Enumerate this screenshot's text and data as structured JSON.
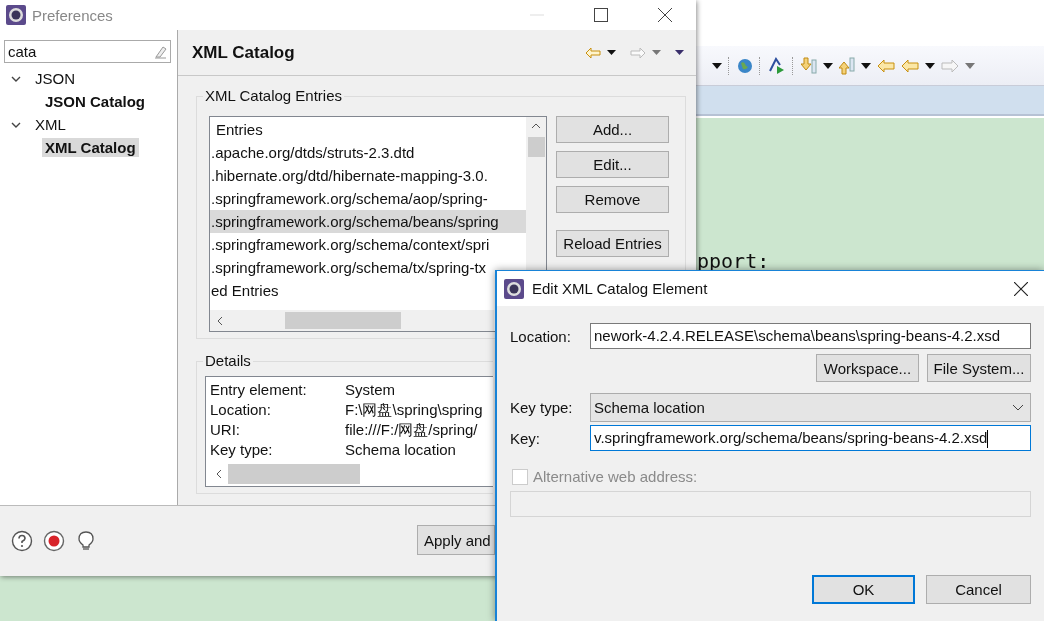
{
  "ide": {
    "editor_text": "pport:"
  },
  "preferences": {
    "title": "Preferences",
    "search": {
      "value": "cata"
    },
    "tree": [
      {
        "label": "JSON",
        "expanded": true,
        "selected": false,
        "children": [
          {
            "label": "JSON Catalog",
            "selected": false
          }
        ]
      },
      {
        "label": "XML",
        "expanded": true,
        "selected": false,
        "children": [
          {
            "label": "XML Catalog",
            "selected": true
          }
        ]
      }
    ],
    "page_title": "XML Catalog",
    "entries_group": "XML Catalog Entries",
    "entries": [
      {
        "text": "Entries",
        "selected": false
      },
      {
        "text": ".apache.org/dtds/struts-2.3.dtd",
        "selected": false
      },
      {
        "text": ".hibernate.org/dtd/hibernate-mapping-3.0.",
        "selected": false
      },
      {
        "text": ".springframework.org/schema/aop/spring-",
        "selected": false
      },
      {
        "text": ".springframework.org/schema/beans/spring",
        "selected": true
      },
      {
        "text": ".springframework.org/schema/context/spri",
        "selected": false
      },
      {
        "text": ".springframework.org/schema/tx/spring-tx",
        "selected": false
      },
      {
        "text": "ed Entries",
        "selected": false
      }
    ],
    "buttons": [
      "Add...",
      "Edit...",
      "Remove",
      "Reload Entries"
    ],
    "details_group": "Details",
    "details": [
      {
        "label": "Entry element:",
        "value": "System"
      },
      {
        "label": "Location:",
        "value": "F:\\网盘\\spring\\spring"
      },
      {
        "label": "URI:",
        "value": "file:///F:/网盘/spring/"
      },
      {
        "label": "Key type:",
        "value": "Schema location"
      }
    ],
    "apply_button": "Apply and"
  },
  "dialog": {
    "title": "Edit XML Catalog Element",
    "location_label": "Location:",
    "location_value": "nework-4.2.4.RELEASE\\schema\\beans\\spring-beans-4.2.xsd",
    "browse_buttons": [
      "Workspace...",
      "File System..."
    ],
    "key_type_label": "Key type:",
    "key_type_value": "Schema location",
    "key_label": "Key:",
    "key_value": "v.springframework.org/schema/beans/spring-beans-4.2.xsd",
    "alternative": {
      "label": "Alternative web address:",
      "checked": false,
      "disabled": true
    },
    "ok_button": "OK",
    "cancel_button": "Cancel"
  }
}
